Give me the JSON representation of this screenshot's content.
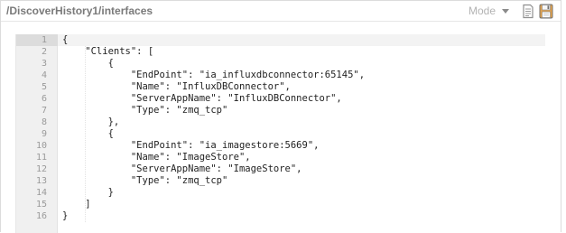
{
  "header": {
    "path_title": "/DiscoverHistory1/interfaces",
    "mode_label": "Mode",
    "icons": [
      "document-icon",
      "save-icon"
    ]
  },
  "editor": {
    "line_numbers": [
      "1",
      "2",
      "3",
      "4",
      "5",
      "6",
      "7",
      "8",
      "9",
      "10",
      "11",
      "12",
      "13",
      "14",
      "15",
      "16"
    ],
    "lines": [
      "{",
      "    \"Clients\": [",
      "        {",
      "            \"EndPoint\": \"ia_influxdbconnector:65145\",",
      "            \"Name\": \"InfluxDBConnector\",",
      "            \"ServerAppName\": \"InfluxDBConnector\",",
      "            \"Type\": \"zmq_tcp\"",
      "        },",
      "        {",
      "            \"EndPoint\": \"ia_imagestore:5669\",",
      "            \"Name\": \"ImageStore\",",
      "            \"ServerAppName\": \"ImageStore\",",
      "            \"Type\": \"zmq_tcp\"",
      "        }",
      "    ]",
      "}"
    ]
  },
  "colors": {
    "gutter_bg": "#f0f0f0",
    "active_gutter_bg": "#dcdcdc",
    "title_color": "#7a7a7a",
    "save_icon_color": "#e8a44a"
  }
}
